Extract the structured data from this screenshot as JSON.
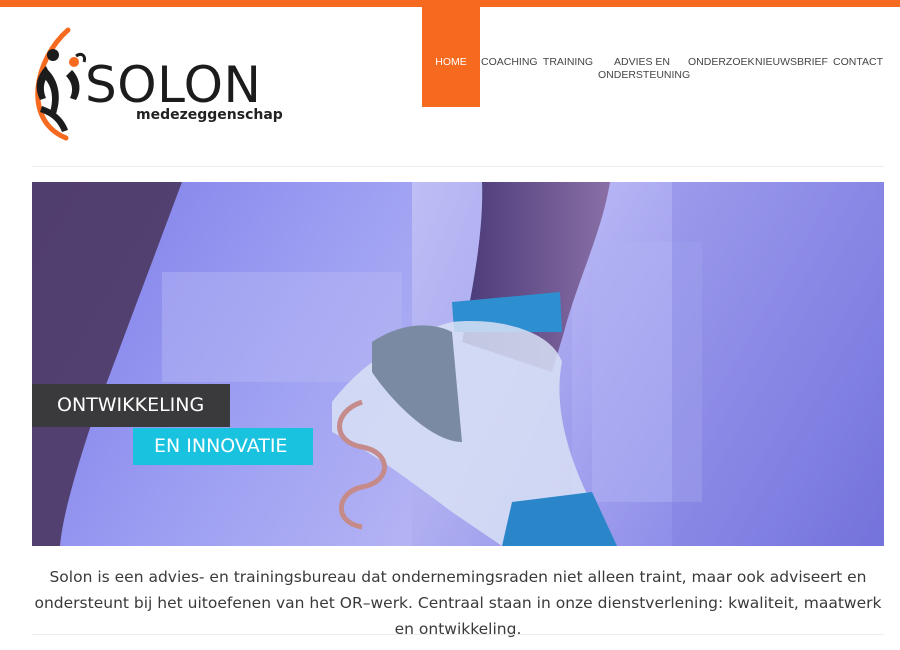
{
  "logo": {
    "name": "SOLON",
    "tagline": "medezeggenschap"
  },
  "nav": {
    "items": [
      {
        "label": "HOME",
        "active": true
      },
      {
        "label": "COACHING"
      },
      {
        "label": "TRAINING"
      },
      {
        "label": "ADVIES EN\nONDERSTEUNING"
      },
      {
        "label": "ONDERZOEK"
      },
      {
        "label": "NIEUWSBRIEF"
      },
      {
        "label": "CONTACT"
      }
    ]
  },
  "hero": {
    "caption_line1": "ONTWIKKELING",
    "caption_line2": "EN INNOVATIE"
  },
  "intro": {
    "text": "Solon is een advies- en trainingsbureau dat ondernemingsraden niet alleen traint, maar ook adviseert en ondersteunt bij het uitoefenen van het OR–werk. Centraal staan in onze dienstverlening: kwaliteit, maatwerk en ontwikkeling."
  },
  "colors": {
    "accent": "#f56a1f",
    "caption_dark": "#3a3a3c",
    "caption_cyan": "#19c3e0"
  }
}
